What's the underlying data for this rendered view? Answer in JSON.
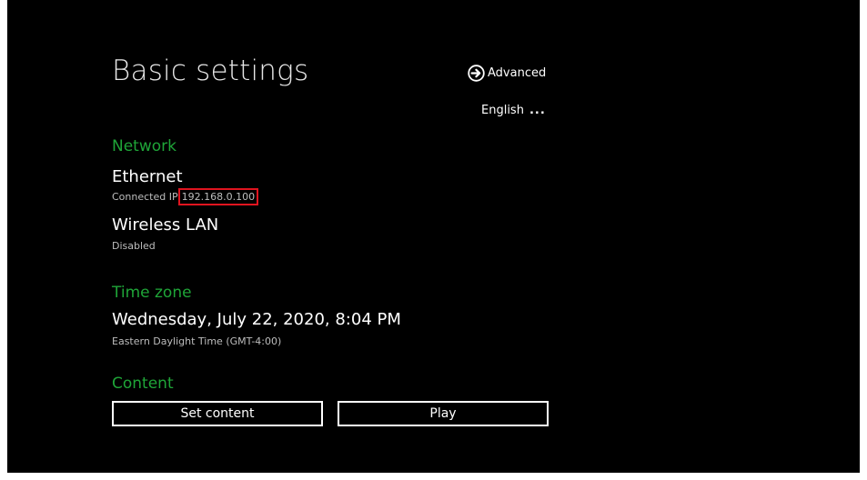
{
  "header": {
    "title": "Basic settings",
    "advanced_label": "Advanced",
    "advanced_icon": "arrow-right-circle-icon",
    "language": "English",
    "language_more": "..."
  },
  "network": {
    "section_title": "Network",
    "ethernet": {
      "title": "Ethernet",
      "status_prefix": "Connected IP",
      "ip_address": "192.168.0.100"
    },
    "wireless": {
      "title": "Wireless LAN",
      "status": "Disabled"
    }
  },
  "timezone": {
    "section_title": "Time zone",
    "datetime": "Wednesday, July 22, 2020, 8:04 PM",
    "zone": "Eastern Daylight Time (GMT-4:00)"
  },
  "content": {
    "section_title": "Content",
    "set_content_label": "Set content",
    "play_label": "Play"
  },
  "colors": {
    "background": "#000000",
    "section_accent": "#1fa538",
    "highlight_box": "#e0141f"
  }
}
